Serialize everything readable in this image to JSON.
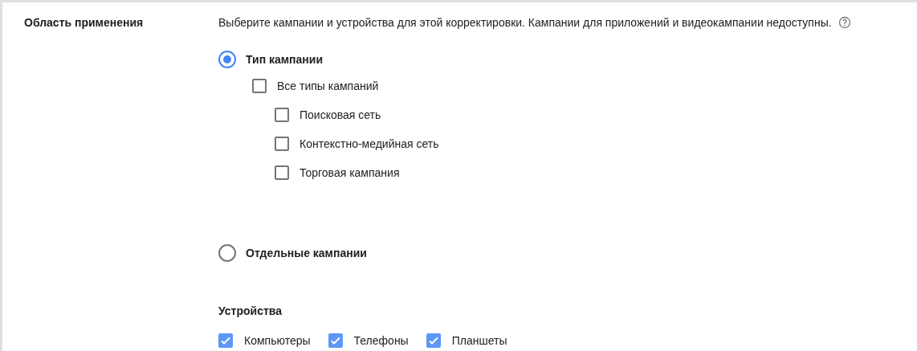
{
  "section": {
    "label": "Область применения",
    "description": "Выберите кампании и устройства для этой корректировки. Кампании для приложений и видеокампании недоступны."
  },
  "scope_options": [
    {
      "label": "Тип кампании",
      "selected": true,
      "campaign_types": [
        {
          "label": "Все типы кампаний",
          "checked": false,
          "children": [
            {
              "label": "Поисковая сеть",
              "checked": false
            },
            {
              "label": "Контекстно-медийная сеть",
              "checked": false
            },
            {
              "label": "Торговая кампания",
              "checked": false
            }
          ]
        }
      ]
    },
    {
      "label": "Отдельные кампании",
      "selected": false
    }
  ],
  "devices": {
    "title": "Устройства",
    "items": [
      {
        "label": "Компьютеры",
        "checked": true
      },
      {
        "label": "Телефоны",
        "checked": true
      },
      {
        "label": "Планшеты",
        "checked": true
      }
    ]
  }
}
